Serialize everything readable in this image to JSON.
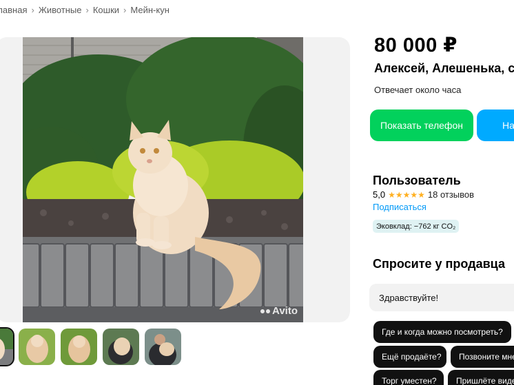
{
  "breadcrumb": {
    "items": [
      "Главная",
      "Животные",
      "Кошки",
      "Мейн-кун"
    ]
  },
  "gallery": {
    "watermark": "Avito",
    "thumbnail_count": 5
  },
  "listing": {
    "price": "80 000 ₽"
  },
  "seller": {
    "name": "Алексей, Алешенька, с",
    "reply_time": "Отвечает около часа"
  },
  "actions": {
    "show_phone": "Показать телефон",
    "write": "Написать"
  },
  "profile": {
    "title": "Пользователь",
    "rating": "5,0",
    "stars": "★★★★★",
    "rating_value": 5,
    "reviews": "18 отзывов",
    "subscribe": "Подписаться",
    "eco": "Эковклад: −762 кг CO₂"
  },
  "ask": {
    "title": "Спросите у продавца",
    "message_value": "Здравствуйте!",
    "chips": [
      "Где и когда можно посмотреть?",
      "Ещё продаёте?",
      "Позвоните мне",
      "Торг уместен?",
      "Пришлёте видео"
    ]
  },
  "colors": {
    "green_button": "#02d15c",
    "blue_button": "#00aaff",
    "link": "#0099f7",
    "stars": "#ffb021",
    "eco_badge": "#dff2f3"
  }
}
